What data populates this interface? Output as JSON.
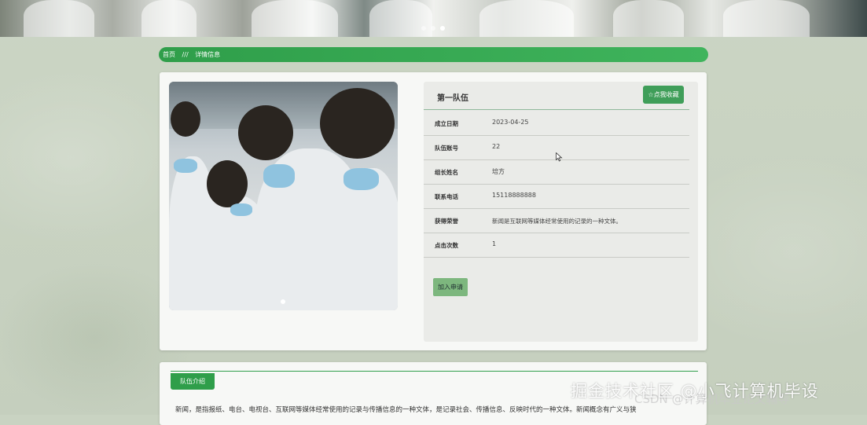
{
  "banner": {
    "slides": 3,
    "active_slide": 3
  },
  "breadcrumb": {
    "home": "首页",
    "sep": "///",
    "current": "详情信息"
  },
  "team": {
    "name": "第一队伍",
    "fav_label": "☆点我收藏",
    "fields": [
      {
        "label": "成立日期",
        "value": "2023-04-25"
      },
      {
        "label": "队伍账号",
        "value": "22"
      },
      {
        "label": "组长姓名",
        "value": "培方"
      },
      {
        "label": "联系电话",
        "value": "15118888888"
      },
      {
        "label": "获得荣誉",
        "value": "新闻是互联网等媒体经常使用的记录的一种文体。"
      },
      {
        "label": "点击次数",
        "value": "1"
      }
    ],
    "apply_label": "加入申请"
  },
  "intro": {
    "tab_label": "队伍介绍",
    "text": "新闻，是指报纸、电台、电视台、互联网等媒体经常使用的记录与传播信息的一种文体，是记录社会、传播信息、反映时代的一种文体。新闻概念有广义与狭"
  },
  "watermark": {
    "line1": "掘金技术社区 @小飞计算机毕设",
    "line2": "CSDN @计算机毕业论文辅导"
  }
}
